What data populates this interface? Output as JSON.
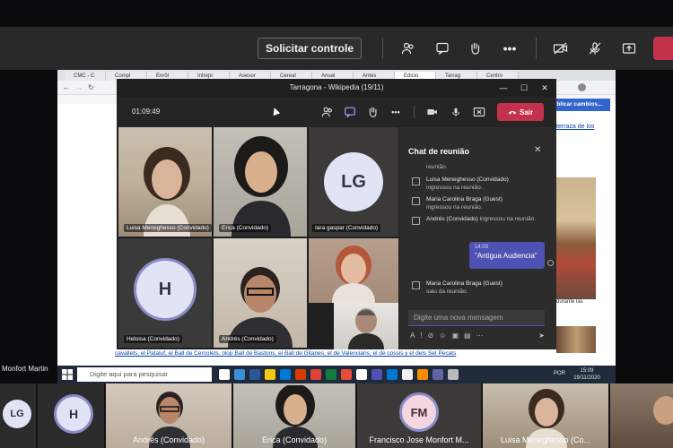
{
  "outer_toolbar": {
    "request_control_label": "Solicitar controle"
  },
  "browser": {
    "tabs": [
      "CMC - C",
      "Compl",
      "Enrôl",
      "Intrepr",
      "Asesor",
      "Cereal",
      "Anual",
      "Antes",
      "Edicio",
      "Tarrag",
      "Centro"
    ],
    "edit_button": "Publicar cambios...",
    "side_link": "terraza de los",
    "caption": "durante las",
    "text_prefix": "cavallets, el Pataluf, el Ball de Cercolets, olop Ball de Bastons, el Ball de Gitanes, el de Valencians, el de cossis y el dels Set Pecats"
  },
  "taskbar": {
    "search_placeholder": "Digite aqui para pesquisar",
    "lang": "POR",
    "time": "15:09",
    "date": "19/11/2020"
  },
  "window": {
    "title": "Tarragona - Wikipedia (19/11)",
    "timer": "01:09:49",
    "leave_label": "Sair"
  },
  "grid": [
    {
      "name": "Luisa Meneghesso (Convidado)"
    },
    {
      "name": "Erica (Convidado)"
    },
    {
      "name": "Iara gaspar (Convidado)",
      "initials": "LG"
    },
    {
      "name": "Heloisa (Convidado)",
      "initials": "H"
    },
    {
      "name": "Andrés (Convidado)"
    }
  ],
  "chat": {
    "title": "Chat de reunião",
    "messages": [
      {
        "pre": "reunião."
      },
      {
        "who": "Luisa Meneghesso (Convidado)",
        "text": "ingressou na reunião."
      },
      {
        "who": "Maria Carolina Braga (Guest)",
        "text": "ingressou na reunião."
      },
      {
        "who": "Andrés (Convidado)",
        "text": "ingressou na reunião."
      },
      {
        "who": "Maria Carolina Braga (Guest)",
        "text": "saiu da reunião."
      }
    ],
    "bubble_time": "14:03",
    "bubble_text": "\"Antigua Audiencia\"",
    "input_placeholder": "Digite uma nova mensagem"
  },
  "strip_label": "Monfort Martin",
  "bottom": [
    {
      "initials": "LG"
    },
    {
      "initials": "H"
    },
    {
      "name": "Andrés (Convidado)"
    },
    {
      "name": "Erica (Convidado)"
    },
    {
      "name": "Francisco Jose Monfort M...",
      "initials": "FM"
    },
    {
      "name": "Luisa Meneghesso (Co..."
    }
  ],
  "colors": {
    "teams_purple": "#4f52b2",
    "leave_red": "#c4314b",
    "wiki_blue": "#3366cc"
  }
}
